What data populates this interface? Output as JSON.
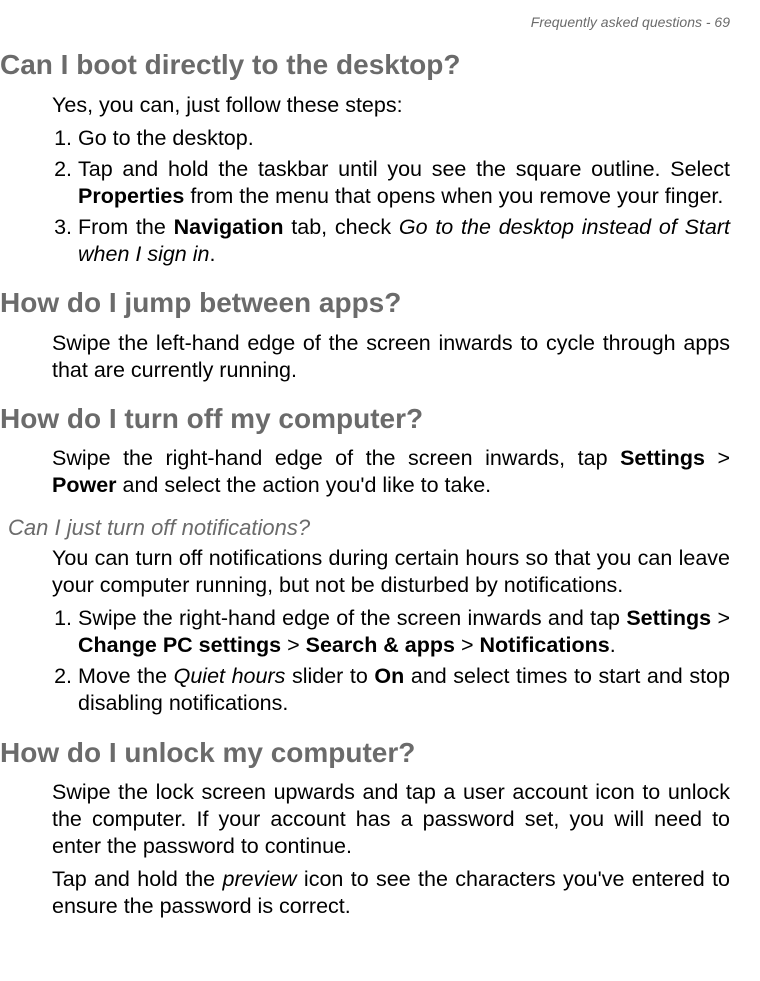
{
  "header": {
    "text": "Frequently asked questions - 69"
  },
  "sections": {
    "boot": {
      "heading": "Can I boot directly to the desktop?",
      "intro": "Yes, you can, just follow these steps:",
      "steps": {
        "s1": "Go to the desktop.",
        "s2a": "Tap and hold the taskbar until you see the square outline. Select ",
        "s2b": "Properties",
        "s2c": " from the menu that opens when you remove your finger.",
        "s3a": "From the ",
        "s3b": "Navigation",
        "s3c": " tab, check ",
        "s3d": "Go to the desktop instead of Start when I sign in",
        "s3e": "."
      }
    },
    "jump": {
      "heading": "How do I jump between apps?",
      "body": "Swipe the left-hand edge of the screen inwards to cycle through apps that are currently running."
    },
    "turnoff": {
      "heading": "How do I turn off my computer?",
      "body_a": "Swipe the right-hand edge of the screen inwards, tap ",
      "body_b": "Settings",
      "body_c": " > ",
      "body_d": "Power",
      "body_e": " and select the action you'd like to take."
    },
    "notifications": {
      "subheading": "Can I just turn off notifications?",
      "intro": "You can turn off notifications during certain hours so that you can leave your computer running, but not be disturbed by notifications.",
      "steps": {
        "s1a": "Swipe the right-hand edge of the screen inwards and tap ",
        "s1b": "Settings",
        "s1c": " > ",
        "s1d": "Change PC settings",
        "s1e": " > ",
        "s1f": "Search & apps",
        "s1g": " > ",
        "s1h": "Notifications",
        "s1i": ".",
        "s2a": "Move the ",
        "s2b": "Quiet hours",
        "s2c": " slider to ",
        "s2d": "On",
        "s2e": " and select times to start and stop disabling notifications."
      }
    },
    "unlock": {
      "heading": "How do I unlock my computer?",
      "p1": "Swipe the lock screen upwards and tap a user account icon to unlock the computer. If your account has a password set, you will need to enter the password to continue.",
      "p2a": "Tap and hold the ",
      "p2b": "preview",
      "p2c": " icon to see the characters you've entered to ensure the password is correct."
    }
  }
}
